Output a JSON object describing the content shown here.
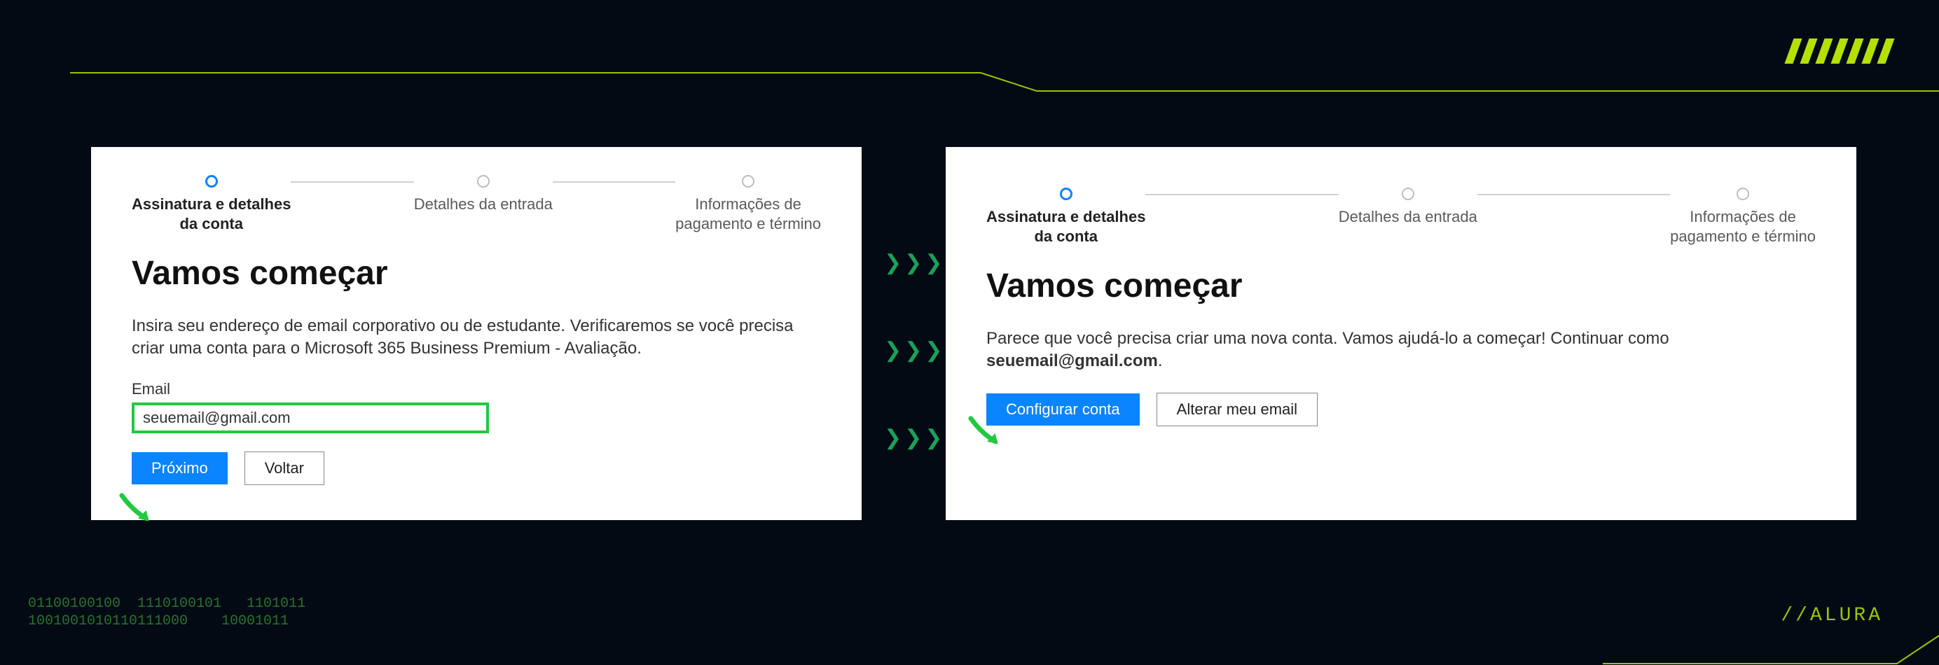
{
  "stepper": {
    "step1": "Assinatura e detalhes\nda conta",
    "step2": "Detalhes da entrada",
    "step3": "Informações de\npagamento e término"
  },
  "heading": "Vamos começar",
  "cardA": {
    "body": "Insira seu endereço de email corporativo ou de estudante. Verificaremos se você precisa criar uma conta para o Microsoft 365 Business Premium - Avaliação.",
    "emailLabel": "Email",
    "emailValue": "seuemail@gmail.com",
    "primary": "Próximo",
    "secondary": "Voltar"
  },
  "cardB": {
    "body_pre": "Parece que você precisa criar uma nova conta. Vamos ajudá-lo a começar! Continuar como ",
    "body_bold": "seuemail@gmail.com",
    "body_post": ".",
    "primary": "Configurar conta",
    "secondary": "Alterar meu email"
  },
  "chevrons": "❯❯❯",
  "binary": "01100100100  1110100101   1101011\n1001001010110111000    10001011  ",
  "brand": "//ALURA"
}
